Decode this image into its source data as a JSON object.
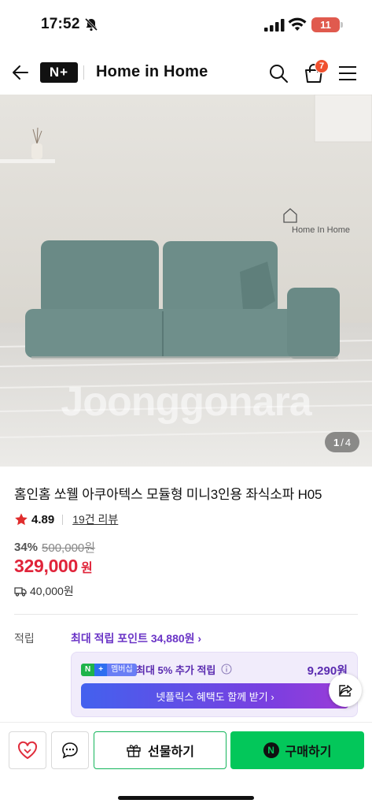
{
  "status_bar": {
    "time": "17:52",
    "battery": "11"
  },
  "header": {
    "logo": "N+",
    "store_name": "Home in Home",
    "cart_count": "7"
  },
  "gallery": {
    "brand_watermark": "Home In Home",
    "watermark_text": "Joonggonara",
    "current": "1",
    "separator": "/",
    "total": "4"
  },
  "product": {
    "title": "홈인홈 쏘웰 아쿠아텍스 모듈형 미니3인용 좌식소파 H05",
    "rating": "4.89",
    "review_count": "19건 리뷰",
    "discount_rate": "34%",
    "original_price": "500,000원",
    "price": "329,000",
    "price_unit": "원",
    "shipping_fee": "40,000원"
  },
  "points": {
    "label": "적립",
    "max_points": "최대 적립 포인트 34,880원 ›"
  },
  "membership": {
    "badge_n": "N",
    "badge_plus": "+",
    "badge_text": "멤버십",
    "benefit": "최대 5% 추가 적립",
    "amount": "9,290원",
    "cta": "넷플릭스 혜택도 함께 받기 ›"
  },
  "bottom_bar": {
    "gift_label": "선물하기",
    "buy_icon_letter": "N",
    "buy_label": "구매하기"
  },
  "colors": {
    "price_red": "#e0243a",
    "naver_green": "#03c75a",
    "membership_purple": "#6a34c6"
  }
}
